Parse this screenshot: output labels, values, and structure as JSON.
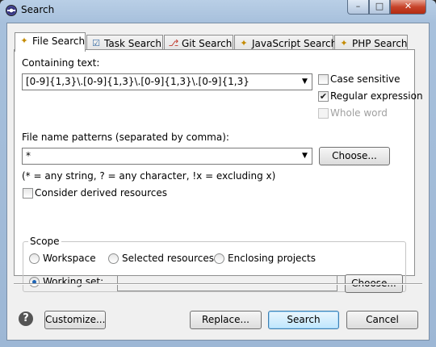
{
  "window": {
    "title": "Search",
    "minimize_glyph": "–",
    "maximize_glyph": "□",
    "close_glyph": "✕"
  },
  "tabs": [
    {
      "label": "File Search",
      "icon": "file-search-icon",
      "glyph": "✦",
      "active": true
    },
    {
      "label": "Task Search",
      "icon": "task-search-icon",
      "glyph": "☑",
      "active": false
    },
    {
      "label": "Git Search",
      "icon": "git-search-icon",
      "glyph": "⎇",
      "active": false
    },
    {
      "label": "JavaScript Search",
      "icon": "javascript-search-icon",
      "glyph": "✦",
      "active": false
    },
    {
      "label": "PHP Search",
      "icon": "php-search-icon",
      "glyph": "✦",
      "active": false
    }
  ],
  "containing_text": {
    "label": "Containing text:",
    "value": "[0-9]{1,3}\\.[0-9]{1,3}\\.[0-9]{1,3}\\.[0-9]{1,3}",
    "arrow": "▼",
    "options": {
      "case_sensitive": {
        "label": "Case sensitive",
        "checked": false,
        "enabled": true
      },
      "regular_expression": {
        "label": "Regular expression",
        "checked": true,
        "enabled": true
      },
      "whole_word": {
        "label": "Whole word",
        "checked": false,
        "enabled": false
      }
    },
    "check_glyph": "✔"
  },
  "file_patterns": {
    "label": "File name patterns (separated by comma):",
    "value": "*",
    "arrow": "▼",
    "choose_label": "Choose...",
    "hint": "(* = any string, ? = any character, !x = excluding x)",
    "derived": {
      "label": "Consider derived resources",
      "checked": false
    }
  },
  "scope": {
    "title": "Scope",
    "selected": "working_set",
    "options": {
      "workspace": "Workspace",
      "selected_resources": "Selected resources",
      "enclosing_projects": "Enclosing projects",
      "working_set": "Working set:"
    },
    "working_set_value": "",
    "choose_label": "Choose..."
  },
  "footer": {
    "help_glyph": "?",
    "customize_label": "Customize...",
    "replace_label": "Replace...",
    "search_label": "Search",
    "cancel_label": "Cancel"
  }
}
